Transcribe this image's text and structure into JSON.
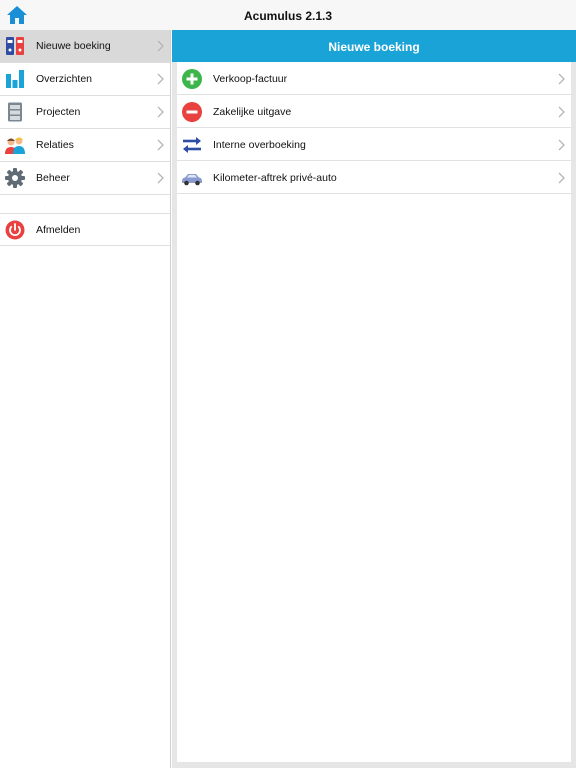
{
  "app": {
    "title": "Acumulus 2.1.3",
    "home_icon": "home-icon",
    "accent": "#1aa3d6"
  },
  "sidebar": {
    "items": [
      {
        "label": "Nieuwe boeking",
        "icon": "binders-icon",
        "active": true
      },
      {
        "label": "Overzichten",
        "icon": "bar-chart-icon",
        "active": false
      },
      {
        "label": "Projecten",
        "icon": "cabinet-icon",
        "active": false
      },
      {
        "label": "Relaties",
        "icon": "people-icon",
        "active": false
      },
      {
        "label": "Beheer",
        "icon": "gear-icon",
        "active": false
      }
    ],
    "logout": {
      "label": "Afmelden",
      "icon": "power-icon"
    }
  },
  "main": {
    "title": "Nieuwe boeking",
    "items": [
      {
        "label": "Verkoop-factuur",
        "icon": "plus-circle-icon",
        "color": "#3cb54a"
      },
      {
        "label": "Zakelijke uitgave",
        "icon": "minus-circle-icon",
        "color": "#e94040"
      },
      {
        "label": "Interne overboeking",
        "icon": "transfer-arrows-icon",
        "color": "#2f4ea3"
      },
      {
        "label": "Kilometer-aftrek privé-auto",
        "icon": "car-icon",
        "color": "#8a9bd0"
      }
    ]
  }
}
